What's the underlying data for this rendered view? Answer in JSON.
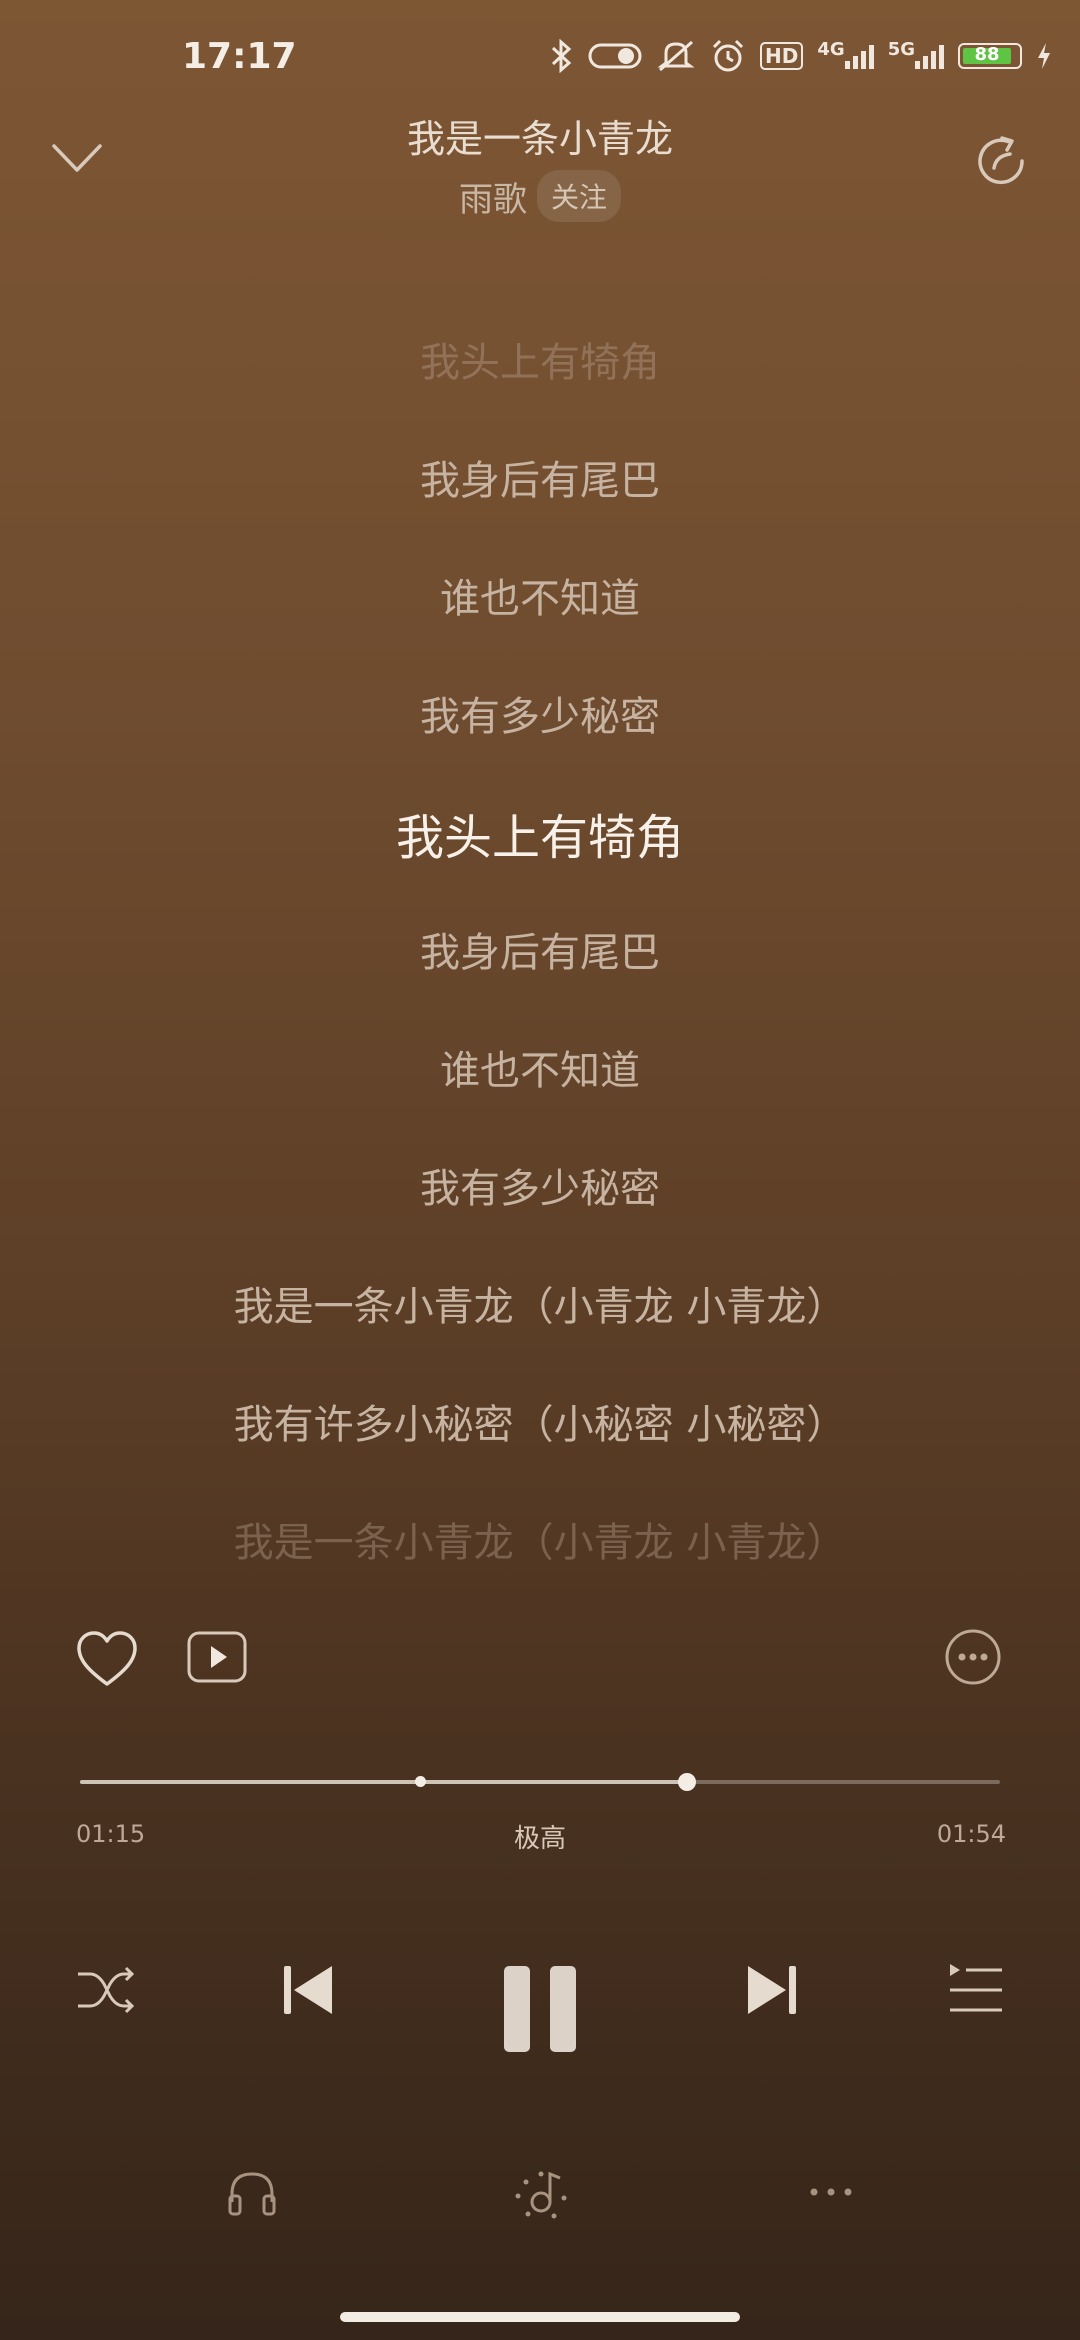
{
  "status_bar": {
    "time": "17:17",
    "hd_label": "HD",
    "net1": "4G",
    "net2": "5G",
    "battery": "88"
  },
  "header": {
    "title": "我是一条小青龙",
    "artist": "雨歌",
    "follow_label": "关注"
  },
  "lyrics": [
    "我头上有犄角",
    "我身后有尾巴",
    "谁也不知道",
    "我有多少秘密",
    "我头上有犄角",
    "我身后有尾巴",
    "谁也不知道",
    "我有多少秘密",
    "我是一条小青龙（小青龙 小青龙）",
    "我有许多小秘密（小秘密 小秘密）",
    "我是一条小青龙（小青龙 小青龙）"
  ],
  "current_lyric_index": 4,
  "player": {
    "current_time": "01:15",
    "total_time": "01:54",
    "quality": "极高",
    "progress_fraction": 0.66,
    "highlight_marker_fraction": 0.37
  },
  "colors": {
    "accent": "#f4ede5",
    "background_top": "#7d5634",
    "background_bottom": "#36251a",
    "battery_green": "#5fc443"
  },
  "icons": {
    "header_left": "chevron-down-icon",
    "header_right": "share-icon",
    "actions": [
      "heart-icon",
      "music-video-icon",
      "more-circle-icon"
    ],
    "controls": [
      "shuffle-icon",
      "previous-icon",
      "pause-icon",
      "next-icon",
      "playlist-icon"
    ],
    "tools": [
      "headphones-icon",
      "audio-effect-icon",
      "more-dots-icon"
    ]
  }
}
